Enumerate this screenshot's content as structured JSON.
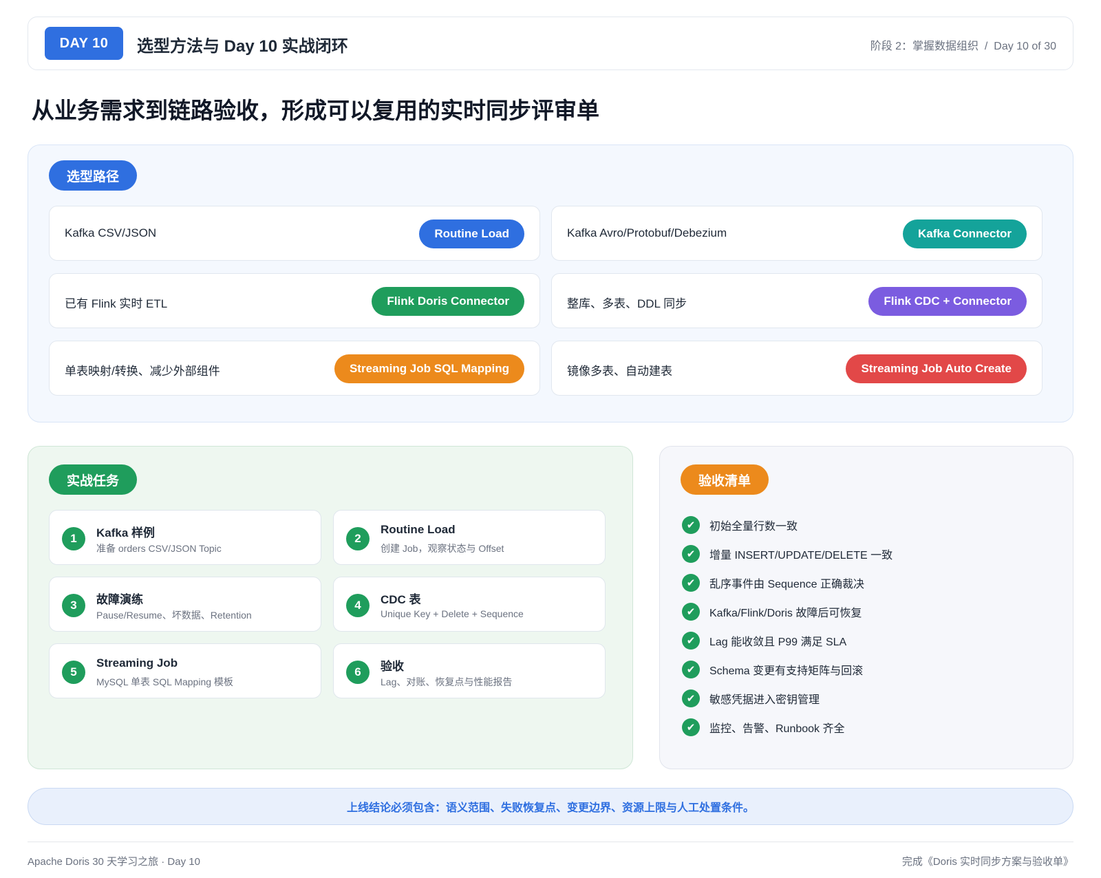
{
  "header": {
    "day_badge": "DAY 10",
    "title": "选型方法与 Day 10 实战闭环",
    "meta": "阶段 2：掌握数据组织  /  Day 10 of 30"
  },
  "headline": "从业务需求到链路验收，形成可以复用的实时同步评审单",
  "selection": {
    "label": "选型路径",
    "label_color": "#2f6fe0",
    "items": [
      {
        "condition": "Kafka CSV/JSON",
        "tool": "Routine Load",
        "color": "#2f6fe0"
      },
      {
        "condition": "Kafka Avro/Protobuf/Debezium",
        "tool": "Kafka Connector",
        "color": "#14a39a"
      },
      {
        "condition": "已有 Flink 实时 ETL",
        "tool": "Flink Doris Connector",
        "color": "#1f9d5c"
      },
      {
        "condition": "整库、多表、DDL 同步",
        "tool": "Flink CDC + Connector",
        "color": "#7b5ce0"
      },
      {
        "condition": "单表映射/转换、减少外部组件",
        "tool": "Streaming Job SQL Mapping",
        "color": "#ec8a1c"
      },
      {
        "condition": "镜像多表、自动建表",
        "tool": "Streaming Job Auto Create",
        "color": "#e24848"
      }
    ]
  },
  "tasks": {
    "label": "实战任务",
    "label_color": "#1f9d5c",
    "items": [
      {
        "num": "1",
        "title": "Kafka 样例",
        "desc": "准备 orders CSV/JSON Topic"
      },
      {
        "num": "2",
        "title": "Routine Load",
        "desc": "创建 Job，观察状态与 Offset"
      },
      {
        "num": "3",
        "title": "故障演练",
        "desc": "Pause/Resume、坏数据、Retention"
      },
      {
        "num": "4",
        "title": "CDC 表",
        "desc": "Unique Key + Delete + Sequence"
      },
      {
        "num": "5",
        "title": "Streaming Job",
        "desc": "MySQL 单表 SQL Mapping 模板"
      },
      {
        "num": "6",
        "title": "验收",
        "desc": "Lag、对账、恢复点与性能报告"
      }
    ]
  },
  "checklist": {
    "label": "验收清单",
    "label_color": "#ec8a1c",
    "check_glyph": "✔",
    "items": [
      "初始全量行数一致",
      "增量 INSERT/UPDATE/DELETE 一致",
      "乱序事件由 Sequence 正确裁决",
      "Kafka/Flink/Doris 故障后可恢复",
      "Lag 能收敛且 P99 满足 SLA",
      "Schema 变更有支持矩阵与回滚",
      "敏感凭据进入密钥管理",
      "监控、告警、Runbook 齐全"
    ]
  },
  "conclusion": "上线结论必须包含：语义范围、失败恢复点、变更边界、资源上限与人工处置条件。",
  "footer": {
    "left": "Apache Doris 30 天学习之旅 · Day 10",
    "right": "完成《Doris 实时同步方案与验收单》"
  }
}
